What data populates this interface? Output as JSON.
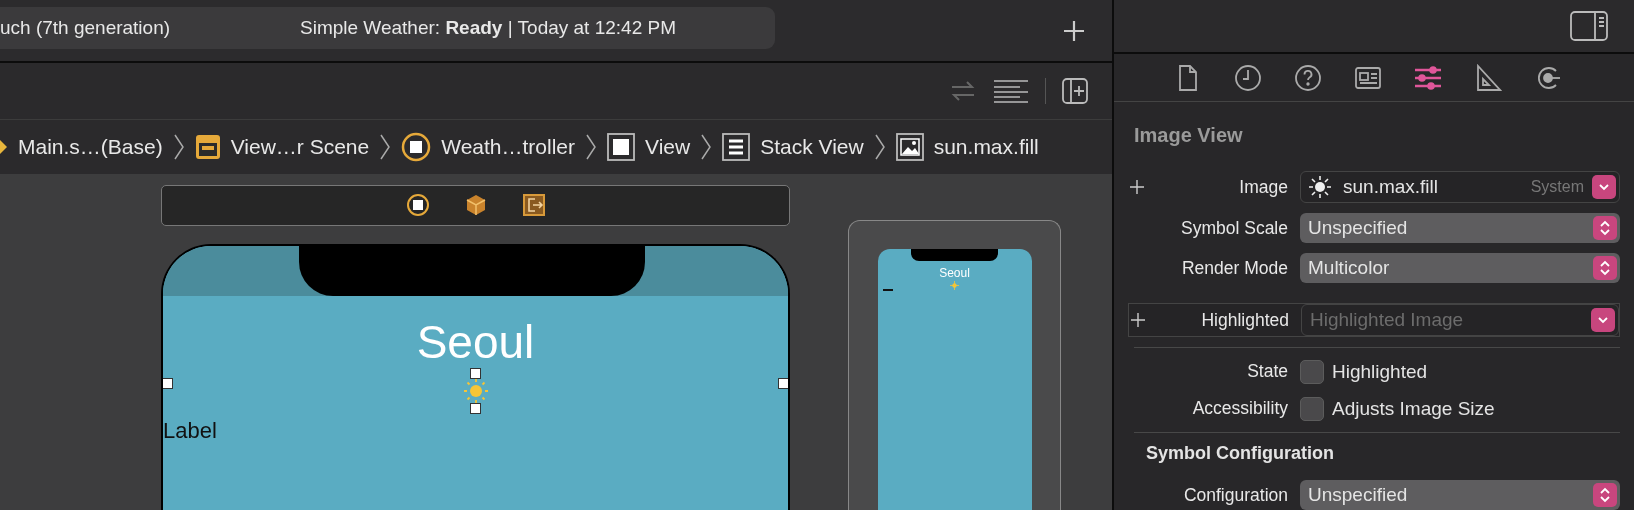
{
  "status": {
    "device": "uch (7th generation)",
    "activity": "Simple Weather: **Ready** | Today at 12:42 PM"
  },
  "breadcrumb": [
    {
      "kind": "storyboard",
      "label": "Main.s…(Base)"
    },
    {
      "kind": "scene",
      "label": "View…r Scene"
    },
    {
      "kind": "controller",
      "label": "Weath…troller"
    },
    {
      "kind": "view",
      "label": "View"
    },
    {
      "kind": "stack",
      "label": "Stack View"
    },
    {
      "kind": "image",
      "label": "sun.max.fill"
    }
  ],
  "canvas": {
    "title": "Seoul",
    "label": "Label",
    "preview_title": "Seoul"
  },
  "inspector": {
    "tabs": [
      {
        "kind": "file",
        "selected": false
      },
      {
        "kind": "history",
        "selected": false
      },
      {
        "kind": "help",
        "selected": false
      },
      {
        "kind": "identity",
        "selected": false
      },
      {
        "kind": "attributes",
        "selected": true
      },
      {
        "kind": "size",
        "selected": false
      },
      {
        "kind": "connections",
        "selected": false
      }
    ],
    "section": "Image View",
    "groups": [
      {
        "rows": [
          {
            "kind": "image",
            "label": "Image",
            "plus": true,
            "value": "sun.max.fill",
            "hint": "System"
          },
          {
            "kind": "popup",
            "label": "Symbol Scale",
            "value": "Unspecified"
          },
          {
            "kind": "popup",
            "label": "Render Mode",
            "value": "Multicolor"
          },
          {
            "kind": "combo",
            "label": "Highlighted",
            "plus": true,
            "placeholder": "Highlighted Image"
          }
        ]
      },
      {
        "rows": [
          {
            "kind": "checkbox",
            "label": "State",
            "text": "Highlighted",
            "checked": false
          },
          {
            "kind": "checkbox",
            "label": "Accessibility",
            "text": "Adjusts Image Size",
            "checked": false
          }
        ]
      }
    ],
    "section2": "Symbol Configuration",
    "rows2": [
      {
        "kind": "popup",
        "label": "Configuration",
        "value": "Unspecified"
      }
    ]
  }
}
